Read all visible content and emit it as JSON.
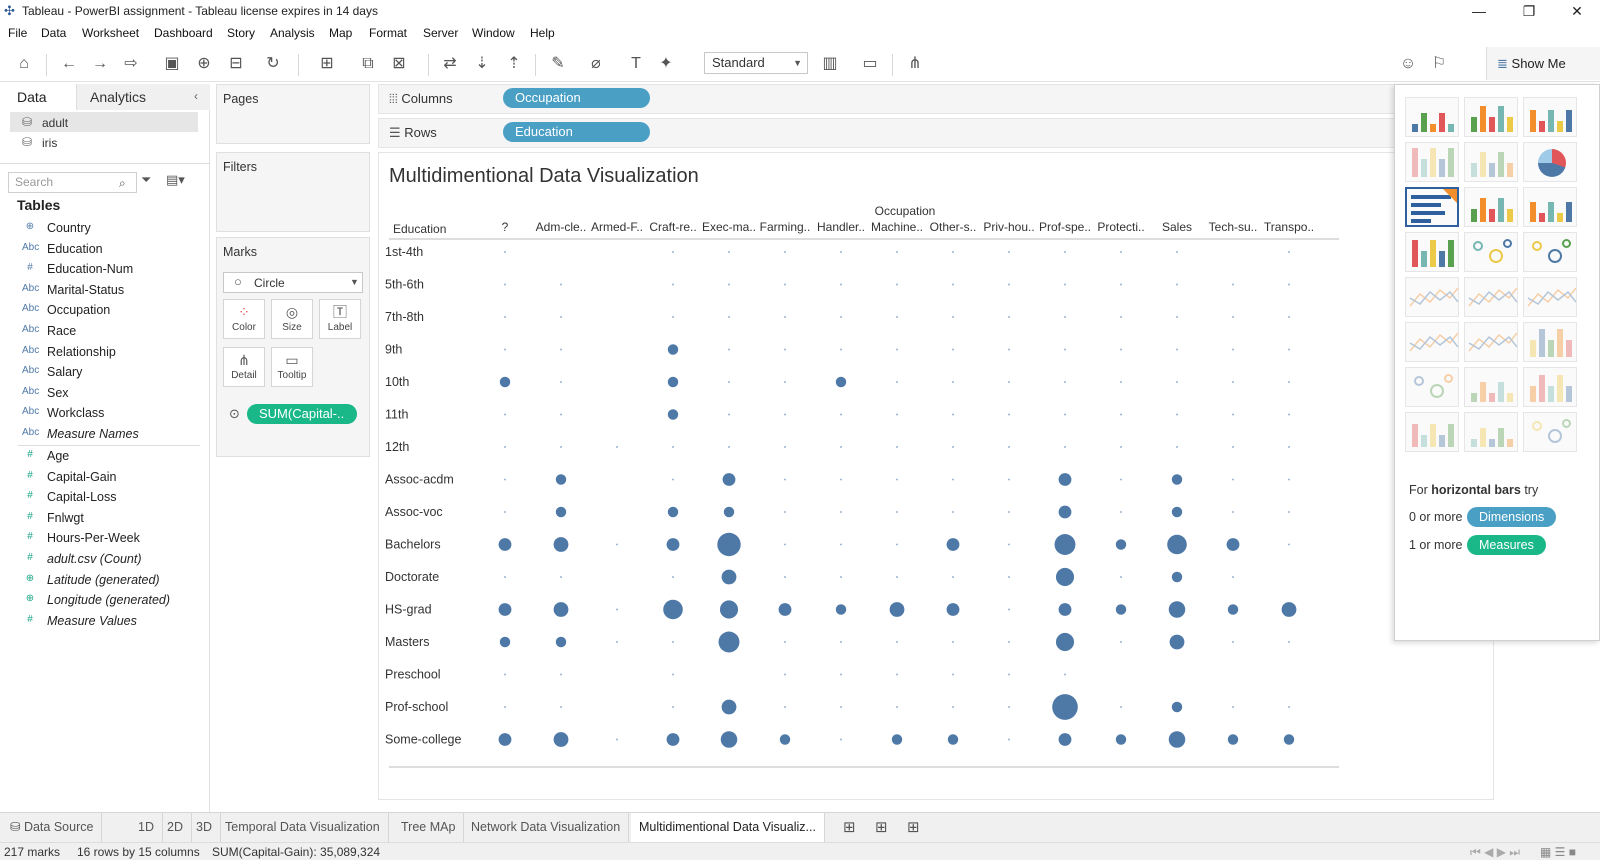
{
  "window": {
    "title": "Tableau - PowerBI assignment - Tableau license expires in 14 days",
    "minimize": "—",
    "maximize": "❐",
    "close": "✕"
  },
  "menu": [
    "File",
    "Data",
    "Worksheet",
    "Dashboard",
    "Story",
    "Analysis",
    "Map",
    "Format",
    "Server",
    "Window",
    "Help"
  ],
  "toolbar": {
    "fit": "Standard",
    "show_me": "Show Me"
  },
  "sidebar": {
    "tab_data": "Data",
    "tab_analytics": "Analytics",
    "datasources": [
      "adult",
      "iris"
    ],
    "search_placeholder": "Search",
    "tables_header": "Tables",
    "dimensions": [
      {
        "type": "geo",
        "name": "Country"
      },
      {
        "type": "abc",
        "name": "Education"
      },
      {
        "type": "num",
        "name": "Education-Num"
      },
      {
        "type": "abc",
        "name": "Marital-Status"
      },
      {
        "type": "abc",
        "name": "Occupation"
      },
      {
        "type": "abc",
        "name": "Race"
      },
      {
        "type": "abc",
        "name": "Relationship"
      },
      {
        "type": "abc",
        "name": "Salary"
      },
      {
        "type": "abc",
        "name": "Sex"
      },
      {
        "type": "abc",
        "name": "Workclass"
      },
      {
        "type": "abc",
        "name": "Measure Names",
        "italic": true
      }
    ],
    "measures": [
      {
        "type": "num",
        "name": "Age"
      },
      {
        "type": "num",
        "name": "Capital-Gain"
      },
      {
        "type": "num",
        "name": "Capital-Loss"
      },
      {
        "type": "num",
        "name": "Fnlwgt"
      },
      {
        "type": "num",
        "name": "Hours-Per-Week"
      },
      {
        "type": "num",
        "name": "adult.csv (Count)",
        "italic": true
      },
      {
        "type": "geo",
        "name": "Latitude (generated)",
        "italic": true
      },
      {
        "type": "geo",
        "name": "Longitude (generated)",
        "italic": true
      },
      {
        "type": "num",
        "name": "Measure Values",
        "italic": true
      }
    ]
  },
  "cards": {
    "pages": "Pages",
    "filters": "Filters",
    "marks": "Marks",
    "mark_type": "Circle",
    "mark_buttons": [
      "Color",
      "Size",
      "Label",
      "Detail",
      "Tooltip"
    ],
    "size_pill": "SUM(Capital-.."
  },
  "shelves": {
    "columns_label": "Columns",
    "columns_pill": "Occupation",
    "rows_label": "Rows",
    "rows_pill": "Education"
  },
  "viz": {
    "title": "Multidimentional Data Visualization"
  },
  "chart_data": {
    "type": "scatter",
    "title": "Multidimentional Data Visualization",
    "xlabel": "Occupation",
    "ylabel": "Education",
    "x": [
      "?",
      "Adm-cle..",
      "Armed-F..",
      "Craft-re..",
      "Exec-ma..",
      "Farming..",
      "Handler..",
      "Machine..",
      "Other-s..",
      "Priv-hou..",
      "Prof-spe..",
      "Protecti..",
      "Sales",
      "Tech-su..",
      "Transpo.."
    ],
    "y": [
      "1st-4th",
      "5th-6th",
      "7th-8th",
      "9th",
      "10th",
      "11th",
      "12th",
      "Assoc-acdm",
      "Assoc-voc",
      "Bachelors",
      "Doctorate",
      "HS-grad",
      "Masters",
      "Preschool",
      "Prof-school",
      "Some-college"
    ],
    "size_measure": "SUM(Capital-Gain)",
    "size_scale": "relative 0-10 (estimated mark size)",
    "sizes": [
      [
        1,
        0,
        0,
        1,
        1,
        1,
        1,
        1,
        1,
        1,
        1,
        1,
        1,
        0,
        1
      ],
      [
        1,
        1,
        0,
        1,
        1,
        1,
        1,
        1,
        1,
        1,
        1,
        1,
        1,
        1,
        1
      ],
      [
        1,
        1,
        0,
        1,
        1,
        1,
        1,
        1,
        1,
        1,
        1,
        1,
        1,
        1,
        1
      ],
      [
        1,
        1,
        0,
        2,
        1,
        1,
        1,
        1,
        1,
        1,
        1,
        1,
        1,
        1,
        1
      ],
      [
        2,
        1,
        0,
        2,
        1,
        1,
        2,
        1,
        1,
        1,
        1,
        1,
        1,
        1,
        1
      ],
      [
        1,
        1,
        0,
        2,
        1,
        1,
        1,
        1,
        1,
        1,
        1,
        1,
        1,
        1,
        1
      ],
      [
        1,
        1,
        1,
        1,
        1,
        1,
        1,
        1,
        1,
        1,
        1,
        1,
        1,
        1,
        1
      ],
      [
        1,
        2,
        0,
        1,
        3,
        1,
        1,
        1,
        1,
        1,
        3,
        1,
        2,
        1,
        1
      ],
      [
        1,
        2,
        0,
        2,
        2,
        1,
        1,
        1,
        1,
        1,
        3,
        1,
        2,
        1,
        1
      ],
      [
        3,
        4,
        1,
        3,
        10,
        1,
        1,
        1,
        3,
        1,
        8,
        2,
        7,
        3,
        1
      ],
      [
        1,
        1,
        0,
        1,
        4,
        1,
        1,
        1,
        1,
        1,
        6,
        1,
        2,
        1,
        0
      ],
      [
        3,
        4,
        1,
        7,
        6,
        3,
        2,
        4,
        3,
        1,
        3,
        2,
        5,
        2,
        4
      ],
      [
        2,
        2,
        1,
        1,
        8,
        1,
        1,
        1,
        1,
        1,
        6,
        1,
        4,
        1,
        1
      ],
      [
        1,
        1,
        0,
        1,
        0,
        1,
        1,
        1,
        1,
        1,
        1,
        0,
        0,
        0,
        0
      ],
      [
        1,
        1,
        0,
        1,
        4,
        1,
        1,
        1,
        1,
        1,
        12,
        1,
        2,
        1,
        1
      ],
      [
        3,
        4,
        1,
        3,
        5,
        2,
        1,
        2,
        2,
        1,
        3,
        2,
        5,
        2,
        2
      ]
    ],
    "color": "#4e79a7",
    "grid": false
  },
  "sheet_tabs": [
    "Data Source",
    "1D",
    "2D",
    "3D",
    "Temporal Data Visualization",
    "Tree MAp",
    "Network Data Visualization",
    "Multidimentional Data Visualiz..."
  ],
  "status": {
    "marks": "217 marks",
    "dims": "16 rows by 15 columns",
    "sum": "SUM(Capital-Gain): 35,089,324"
  },
  "showme": {
    "hint_prefix": "For",
    "hint_bold": "horizontal bars",
    "hint_suffix": "try",
    "dim_req": "0 or more",
    "dim_pill": "Dimensions",
    "mea_req": "1 or more",
    "mea_pill": "Measures",
    "charts": [
      "text-table",
      "heat-map",
      "highlight-table",
      "symbol-map",
      "filled-map",
      "pie-chart",
      "horizontal-bars",
      "stacked-bars",
      "side-by-side-bars",
      "treemap",
      "circle-views",
      "side-by-side-circles",
      "continuous-lines",
      "discrete-lines",
      "dual-lines",
      "area-continuous",
      "area-discrete",
      "dual-combination",
      "scatter-plot",
      "histogram",
      "box-whisker",
      "gantt-chart",
      "bullet-graph",
      "packed-bubbles"
    ]
  }
}
